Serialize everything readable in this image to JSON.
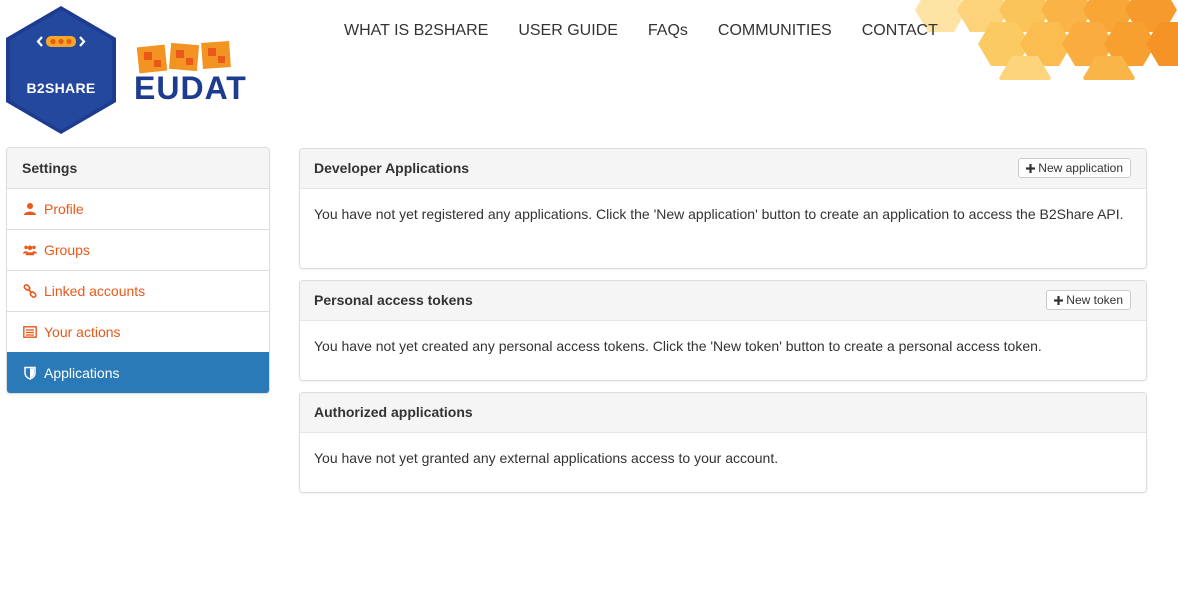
{
  "header": {
    "logo_b2share": "B2SHARE",
    "logo_eudat": "EUDAT",
    "nav": [
      {
        "label": "WHAT IS B2SHARE"
      },
      {
        "label": "USER GUIDE"
      },
      {
        "label": "FAQs"
      },
      {
        "label": "COMMUNITIES"
      },
      {
        "label": "CONTACT"
      }
    ]
  },
  "sidebar": {
    "title": "Settings",
    "items": [
      {
        "label": "Profile",
        "icon": "user-icon",
        "active": false
      },
      {
        "label": "Groups",
        "icon": "users-icon",
        "active": false
      },
      {
        "label": "Linked accounts",
        "icon": "link-icon",
        "active": false
      },
      {
        "label": "Your actions",
        "icon": "list-icon",
        "active": false
      },
      {
        "label": "Applications",
        "icon": "shield-icon",
        "active": true
      }
    ]
  },
  "panels": {
    "developer": {
      "title": "Developer Applications",
      "button": "New application",
      "body": "You have not yet registered any applications. Click the 'New application' button to create an application to access the B2Share API."
    },
    "tokens": {
      "title": "Personal access tokens",
      "button": "New token",
      "body": "You have not yet created any personal access tokens. Click the 'New token' button to create a personal access token."
    },
    "authorized": {
      "title": "Authorized applications",
      "body": "You have not yet granted any external applications access to your account."
    }
  },
  "colors": {
    "accent": "#e8591a",
    "active": "#2a7ab8",
    "logo_blue": "#1d3b8f",
    "honeycomb": "#f7a728"
  }
}
